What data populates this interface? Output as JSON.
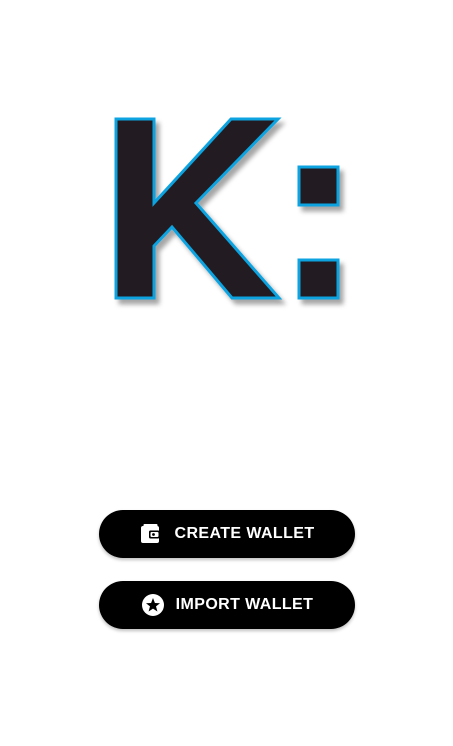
{
  "logo": {
    "text": "K:",
    "fill_color": "#231f20",
    "outline_color": "#0aa3e0"
  },
  "actions": {
    "create_wallet": {
      "label": "CREATE WALLET",
      "icon": "wallet-icon"
    },
    "import_wallet": {
      "label": "IMPORT WALLET",
      "icon": "star-circle-icon"
    }
  },
  "colors": {
    "background": "#ffffff",
    "button_bg": "#000000",
    "button_text": "#ffffff"
  }
}
